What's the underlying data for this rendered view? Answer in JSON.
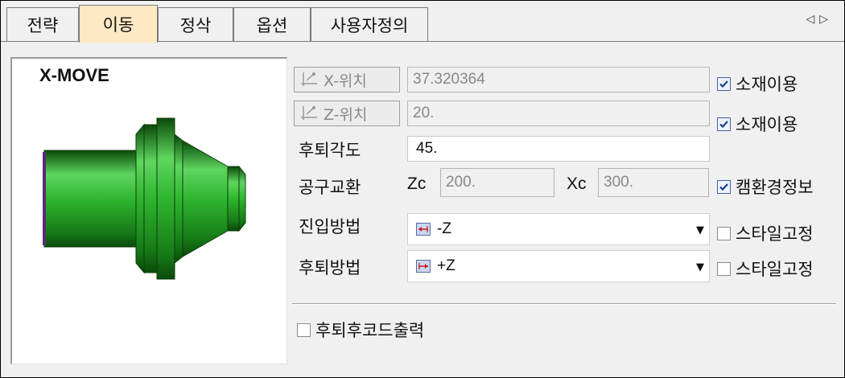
{
  "tabs": [
    {
      "label": "전략",
      "active": false
    },
    {
      "label": "이동",
      "active": true
    },
    {
      "label": "정삭",
      "active": false
    },
    {
      "label": "옵션",
      "active": false
    },
    {
      "label": "사용자정의",
      "active": false
    }
  ],
  "tab_scroll": {
    "left": "◁",
    "right": "▷"
  },
  "preview": {
    "title": "X-MOVE",
    "part_color": "#1fa11f"
  },
  "x_position": {
    "button_label": "X-위치",
    "value": "37.320364",
    "checkbox_label": "소재이용",
    "checked": true
  },
  "z_position": {
    "button_label": "Z-위치",
    "value": "20.",
    "checkbox_label": "소재이용",
    "checked": true
  },
  "retract_angle": {
    "label": "후퇴각도",
    "value": "45."
  },
  "tool_change": {
    "label": "공구교환",
    "zc_label": "Zc",
    "zc_value": "200.",
    "xc_label": "Xc",
    "xc_value": "300.",
    "checkbox_label": "캠환경정보",
    "checked": true
  },
  "approach": {
    "label": "진입방법",
    "value": "-Z",
    "checkbox_label": "스타일고정",
    "checked": false
  },
  "retract": {
    "label": "후퇴방법",
    "value": "+Z",
    "checkbox_label": "스타일고정",
    "checked": false
  },
  "retract_code": {
    "checkbox_label": "후퇴후코드출력",
    "checked": false
  },
  "colors": {
    "active_tab": "#ffe9c4",
    "check": "#1a3f8a",
    "arrow_icon": "#d01a1a"
  }
}
